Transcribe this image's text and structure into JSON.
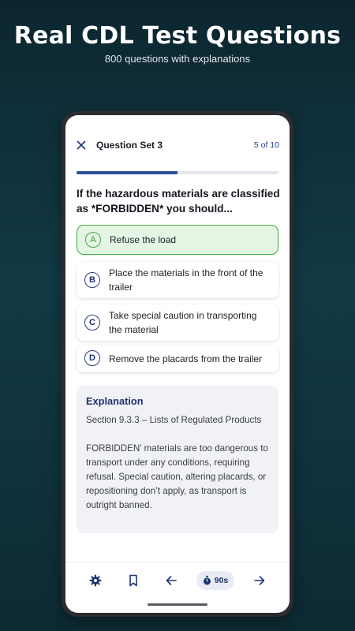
{
  "promo": {
    "headline": "Real CDL Test Questions",
    "subline": "800 questions with explanations"
  },
  "header": {
    "close_icon": "close-icon",
    "title": "Question Set 3",
    "counter": "5 of 10"
  },
  "progress": {
    "current": 5,
    "total": 10,
    "fraction": 0.5,
    "color": "#2a4d9c"
  },
  "question": "If the hazardous materials are classified as *FORBIDDEN* you should...",
  "options": [
    {
      "letter": "A",
      "text": "Refuse the load",
      "state": "correct"
    },
    {
      "letter": "B",
      "text": "Place the materials in the front of the trailer",
      "state": "default"
    },
    {
      "letter": "C",
      "text": "Take special caution in transporting the material",
      "state": "default"
    },
    {
      "letter": "D",
      "text": "Remove the placards from the trailer",
      "state": "default"
    }
  ],
  "explanation": {
    "title": "Explanation",
    "section": "Section 9.3.3 – Lists of Regulated Products",
    "body": "FORBIDDEN’ materials are too dangerous to transport under any conditions, requiring refusal. Special caution, altering placards, or repositioning don’t apply, as transport is outright banned."
  },
  "bottom_nav": {
    "settings_icon": "gear-icon",
    "bookmark_icon": "bookmark-icon",
    "prev_icon": "arrow-left-icon",
    "timer_icon": "stopwatch-icon",
    "timer_label": "90s",
    "next_icon": "arrow-right-icon"
  },
  "colors": {
    "accent": "#1e3470",
    "correct_border": "#3eaa3e",
    "correct_fill": "#e5f5e4",
    "background": "#123a45"
  }
}
